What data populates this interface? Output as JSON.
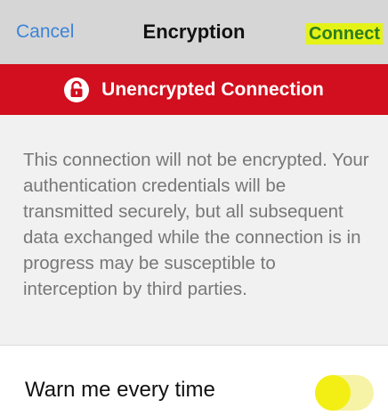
{
  "navbar": {
    "cancel_label": "Cancel",
    "title": "Encryption",
    "connect_label": "Connect"
  },
  "banner": {
    "icon": "lock-open-icon",
    "text": "Unencrypted Connection",
    "color": "#d10f1e"
  },
  "description": {
    "text": "This connection will not be encrypted. Your authentication credentials will be transmitted securely, but all subsequent data exchanged while the connection is in progress may be susceptible to interception by third parties."
  },
  "settings": {
    "warn_label": "Warn me every time",
    "warn_toggle_on": true
  },
  "colors": {
    "link_blue": "#3d84d8",
    "highlight_yellow": "#e4f217",
    "toggle_yellow": "#f3ef14"
  }
}
